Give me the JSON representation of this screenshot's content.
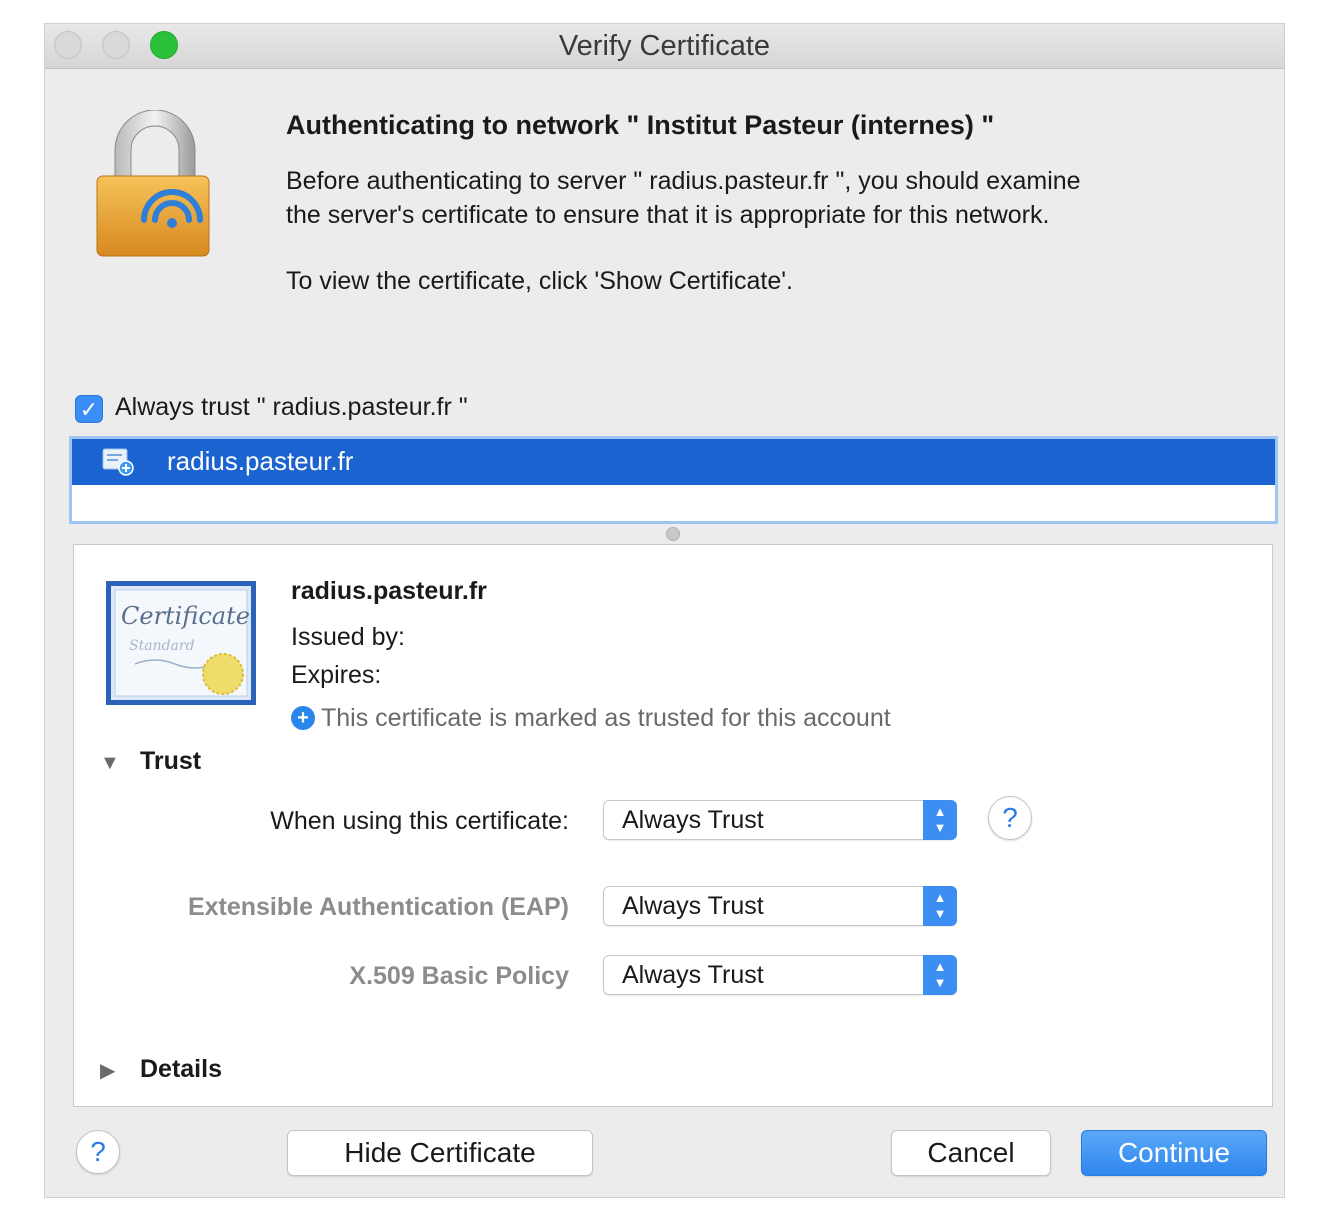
{
  "window": {
    "title": "Verify Certificate"
  },
  "header": {
    "title": "Authenticating to network \" Institut Pasteur (internes) \"",
    "line1": "Before authenticating to server \" radius.pasteur.fr          \", you should examine",
    "line2": "the server's certificate to ensure that it is appropriate for this network.",
    "line3": "To view the certificate, click 'Show Certificate'."
  },
  "always_trust": {
    "checked": true,
    "label": "Always trust \" radius.pasteur.fr    \""
  },
  "cert_list": {
    "items": [
      {
        "label": "radius.pasteur.fr"
      }
    ]
  },
  "cert_detail": {
    "name": "radius.pasteur.fr",
    "issued_by": "Issued by:",
    "expires": "Expires:",
    "trusted_note": "This certificate is marked as trusted for this account",
    "trust_section": "Trust",
    "details_section": "Details",
    "policies": [
      {
        "label": "When using this certificate:",
        "value": "Always Trust"
      },
      {
        "label": "Extensible Authentication (EAP)",
        "value": "Always Trust"
      },
      {
        "label": "X.509 Basic Policy",
        "value": "Always Trust"
      }
    ]
  },
  "icons": {
    "help": "?",
    "plus": "+",
    "check": "✓",
    "tri_down": "▼",
    "tri_right": "▶",
    "stepper": "⌃⌄"
  },
  "buttons": {
    "hide": "Hide Certificate",
    "cancel": "Cancel",
    "continue": "Continue"
  },
  "colors": {
    "accent": "#2f86ee",
    "selection": "#1b63d0",
    "traffic_zoom": "#2cc13a"
  }
}
